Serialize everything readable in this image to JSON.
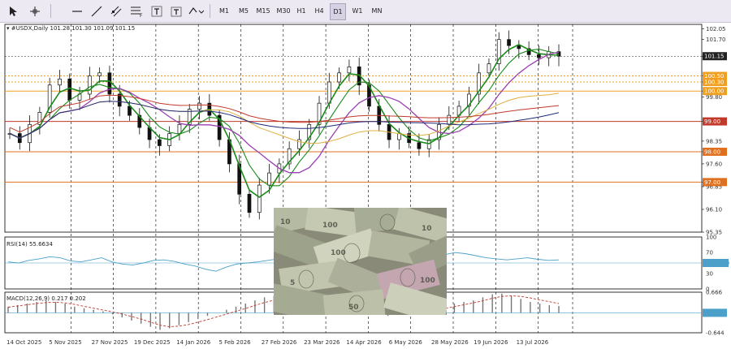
{
  "toolbar": {
    "timeframes": [
      "M1",
      "M5",
      "M15",
      "M30",
      "H1",
      "H4",
      "D1",
      "W1",
      "MN"
    ],
    "active_timeframe": "D1",
    "tools": [
      "cursor-icon",
      "crosshair-icon",
      "horizontal-line-icon",
      "trend-line-icon",
      "channel-icon",
      "fibonacci-icon",
      "text-icon",
      "label-icon",
      "shapes-icon"
    ]
  },
  "main": {
    "header": "#USDX,Daily  101.28 101.30 101.09 101.15"
  },
  "rsi": {
    "header": "RSI(14) 55.6634"
  },
  "macd": {
    "header": "MACD(12,26,9) 0.217 0.202"
  },
  "colors": {
    "candle": "#111111",
    "ma_fast": "#1a8a1a",
    "ma_mid": "#9b3fb3",
    "ma_slow": "#e0b040",
    "ma_navy": "#1f2a7a",
    "ma_red": "#c0392b",
    "level_orange": "#f0a020",
    "level_red": "#c0392b",
    "rsi_line": "#4aa0c8",
    "macd_signal": "#c0392b"
  },
  "chart_data": {
    "type": "candlestick",
    "symbol": "#USDX",
    "timeframe": "Daily",
    "ohlc_last": {
      "open": 101.28,
      "high": 101.3,
      "low": 101.09,
      "close": 101.15
    },
    "price_axis_ticks": [
      "102.05",
      "101.70",
      "101.15",
      "100.50",
      "100.30",
      "100.00",
      "99.80",
      "99.00",
      "98.35",
      "98.00",
      "97.60",
      "97.00",
      "96.85",
      "96.10",
      "95.35"
    ],
    "price_axis_values": [
      102.05,
      101.7,
      101.15,
      100.5,
      100.3,
      100.0,
      99.8,
      99.0,
      98.35,
      98.0,
      97.6,
      97.0,
      96.85,
      96.1,
      95.35
    ],
    "ylim": [
      95.35,
      102.2
    ],
    "levels": [
      {
        "price": 100.5,
        "label": "100.50",
        "color": "#f0a020"
      },
      {
        "price": 100.3,
        "label": "100.30",
        "color": "#f0a020"
      },
      {
        "price": 100.0,
        "label": "100.00",
        "color": "#f0a020"
      },
      {
        "price": 99.0,
        "label": "99.00",
        "color": "#c0392b"
      },
      {
        "price": 98.0,
        "label": "98.00",
        "color": "#e07020"
      },
      {
        "price": 97.0,
        "label": "97.00",
        "color": "#e07020"
      },
      {
        "price": 101.15,
        "label": "101.15",
        "color": "#222222"
      }
    ],
    "x_ticks": [
      "14 Oct 2025",
      "5 Nov 2025",
      "27 Nov 2025",
      "19 Dec 2025",
      "14 Jan 2026",
      "5 Feb 2026",
      "27 Feb 2026",
      "23 Mar 2026",
      "14 Apr 2026",
      "6 May 2026",
      "28 May 2026",
      "19 Jun 2026",
      "13 Jul 2026"
    ],
    "close_path": [
      98.6,
      98.3,
      98.9,
      99.3,
      100.2,
      100.4,
      99.7,
      99.9,
      100.5,
      100.6,
      99.9,
      99.5,
      99.2,
      98.8,
      98.4,
      98.2,
      98.6,
      98.9,
      99.4,
      99.6,
      99.2,
      98.4,
      97.6,
      96.6,
      96.0,
      96.9,
      97.3,
      97.6,
      98.1,
      98.4,
      98.9,
      99.6,
      100.3,
      100.6,
      100.8,
      100.2,
      99.5,
      98.9,
      98.4,
      98.6,
      98.3,
      98.1,
      98.4,
      98.9,
      99.2,
      99.5,
      99.9,
      100.6,
      100.9,
      101.7,
      101.5,
      101.4,
      101.2,
      101.1,
      101.3,
      101.15
    ],
    "rsi": {
      "ticks": [
        "100",
        "70",
        "50.0000",
        "30",
        "0"
      ],
      "tick_values": [
        100,
        70,
        50,
        30,
        0
      ],
      "level": 50,
      "values": [
        52,
        50,
        55,
        58,
        62,
        60,
        54,
        52,
        56,
        60,
        52,
        48,
        46,
        50,
        55,
        56,
        53,
        48,
        44,
        38,
        34,
        42,
        48,
        50,
        52,
        55,
        58,
        62,
        66,
        64,
        60,
        56,
        52,
        50,
        54,
        52,
        48,
        50,
        55,
        58,
        60,
        62,
        66,
        70,
        68,
        64,
        60,
        58,
        56,
        58,
        60,
        57,
        55,
        56
      ]
    },
    "macd": {
      "ticks": [
        "0.666",
        "0.000",
        "-0.644"
      ],
      "tick_values": [
        0.666,
        0.0,
        -0.644
      ],
      "hist": [
        0.2,
        0.25,
        0.3,
        0.35,
        0.4,
        0.35,
        0.3,
        0.2,
        0.15,
        0.1,
        0.05,
        -0.05,
        -0.15,
        -0.25,
        -0.35,
        -0.45,
        -0.55,
        -0.5,
        -0.4,
        -0.3,
        -0.2,
        -0.1,
        0.0,
        0.1,
        0.2,
        0.3,
        0.4,
        0.5,
        0.55,
        0.6,
        0.58,
        0.55,
        0.5,
        0.45,
        0.4,
        0.3,
        0.2,
        0.1,
        0.0,
        -0.05,
        -0.1,
        -0.05,
        0.0,
        0.05,
        0.1,
        0.15,
        0.2,
        0.3,
        0.35,
        0.4,
        0.5,
        0.6,
        0.62,
        0.55,
        0.45,
        0.35,
        0.3,
        0.25,
        0.22
      ],
      "signal": [
        0.18,
        0.22,
        0.26,
        0.3,
        0.33,
        0.34,
        0.32,
        0.27,
        0.21,
        0.15,
        0.09,
        0.03,
        -0.04,
        -0.12,
        -0.2,
        -0.3,
        -0.4,
        -0.45,
        -0.43,
        -0.38,
        -0.3,
        -0.22,
        -0.13,
        -0.04,
        0.05,
        0.14,
        0.24,
        0.33,
        0.41,
        0.48,
        0.53,
        0.55,
        0.54,
        0.51,
        0.46,
        0.4,
        0.33,
        0.25,
        0.17,
        0.1,
        0.04,
        0.01,
        0.0,
        0.02,
        0.05,
        0.09,
        0.14,
        0.2,
        0.26,
        0.32,
        0.39,
        0.47,
        0.53,
        0.55,
        0.53,
        0.48,
        0.42,
        0.36,
        0.3
      ]
    }
  }
}
